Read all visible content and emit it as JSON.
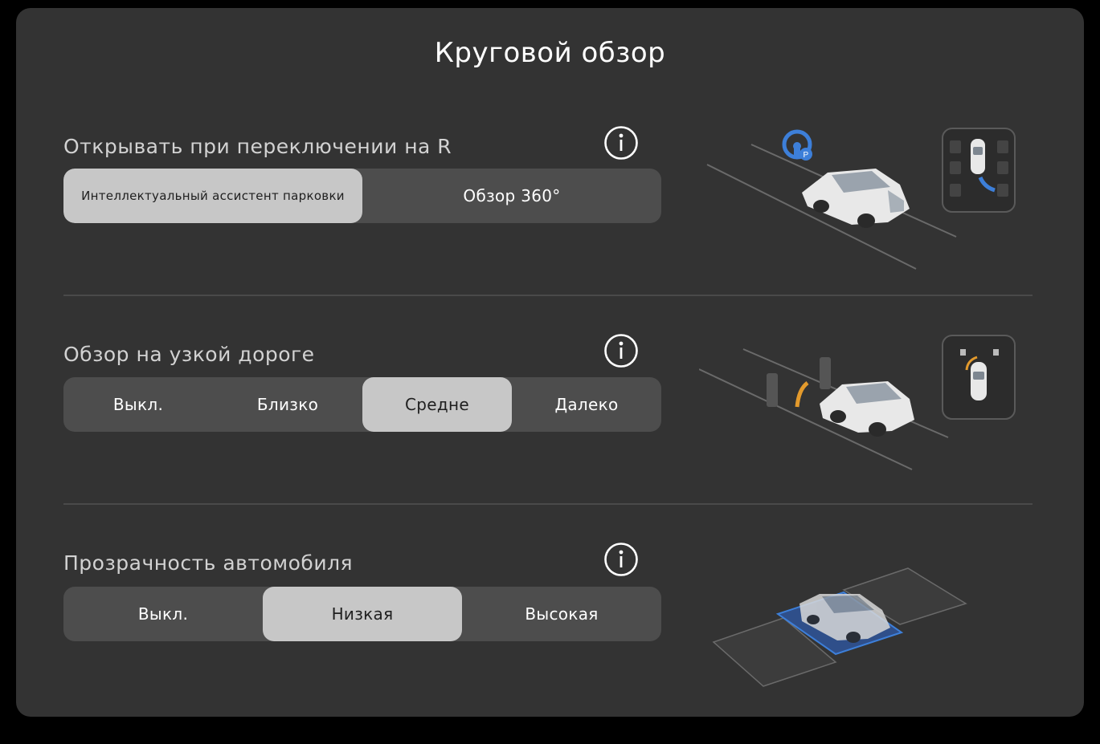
{
  "title": "Круговой обзор",
  "sections": [
    {
      "label": "Открывать при переключении на R",
      "options": [
        "Интеллектуальный ассистент парковки",
        "Обзор 360°"
      ],
      "selected": "Интеллектуальный ассистент парковки"
    },
    {
      "label": "Обзор на узкой дороге",
      "options": [
        "Выкл.",
        "Близко",
        "Средне",
        "Далеко"
      ],
      "selected": "Средне"
    },
    {
      "label": "Прозрачность автомобиля",
      "options": [
        "Выкл.",
        "Низкая",
        "Высокая"
      ],
      "selected": "Низкая"
    }
  ],
  "icons": {
    "info": "info-icon",
    "steering_p": "parking-assist-steering-icon"
  },
  "colors": {
    "panel": "#333333",
    "segment_bg": "#4d4d4d",
    "segment_active": "#c7c7c7",
    "accent_blue": "#3d7fd9",
    "accent_orange": "#e39a2c"
  }
}
